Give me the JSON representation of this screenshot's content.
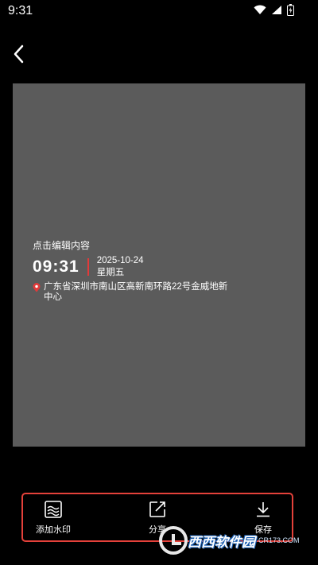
{
  "status_bar": {
    "time": "9:31"
  },
  "watermark": {
    "edit_hint": "点击编辑内容",
    "time": "09:31",
    "date": "2025-10-24",
    "weekday": "星期五",
    "location": "广东省深圳市南山区高新南环路22号金威地新中心"
  },
  "toolbar": {
    "items": [
      {
        "label": "添加水印",
        "icon": "waves-icon"
      },
      {
        "label": "分享",
        "icon": "share-icon"
      },
      {
        "label": "保存",
        "icon": "download-icon"
      }
    ]
  },
  "brand_overlay": {
    "name": "西西软件园",
    "url": "CR173.COM"
  },
  "colors": {
    "canvas": "#5b5b5b",
    "accent": "#e4413a",
    "background": "#000000"
  }
}
